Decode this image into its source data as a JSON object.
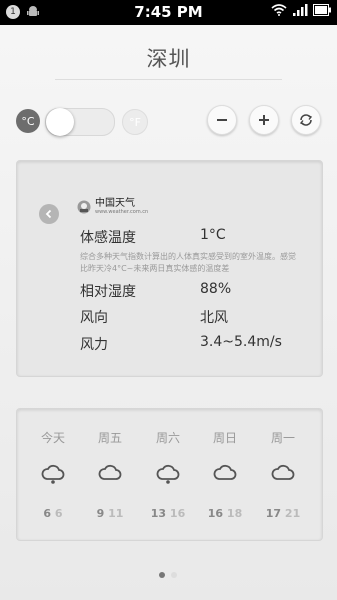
{
  "status_bar": {
    "notification_count": "1",
    "time": "7:45 PM"
  },
  "city": "深圳",
  "units": {
    "celsius": "°C",
    "fahrenheit": "°F"
  },
  "source": {
    "name": "中国天气",
    "url": "www.weather.com.cn"
  },
  "details": {
    "feels_like_label": "体感温度",
    "feels_like_value": "1°C",
    "description": "综合多种天气指数计算出的人体真实感受到的室外温度。感觉比昨天冷4°C~未来两日真实体感的温度差",
    "humidity_label": "相对湿度",
    "humidity_value": "88%",
    "wind_dir_label": "风向",
    "wind_dir_value": "北风",
    "wind_speed_label": "风力",
    "wind_speed_value": "3.4~5.4m/s"
  },
  "forecast": [
    {
      "day": "今天",
      "low": "6",
      "high": "6",
      "icon": "cloud-rain-icon"
    },
    {
      "day": "周五",
      "low": "9",
      "high": "11",
      "icon": "cloud-icon"
    },
    {
      "day": "周六",
      "low": "13",
      "high": "16",
      "icon": "cloud-rain-icon"
    },
    {
      "day": "周日",
      "low": "16",
      "high": "18",
      "icon": "cloud-icon"
    },
    {
      "day": "周一",
      "low": "17",
      "high": "21",
      "icon": "cloud-icon"
    }
  ],
  "pager": {
    "pages": 2,
    "current": 1
  }
}
